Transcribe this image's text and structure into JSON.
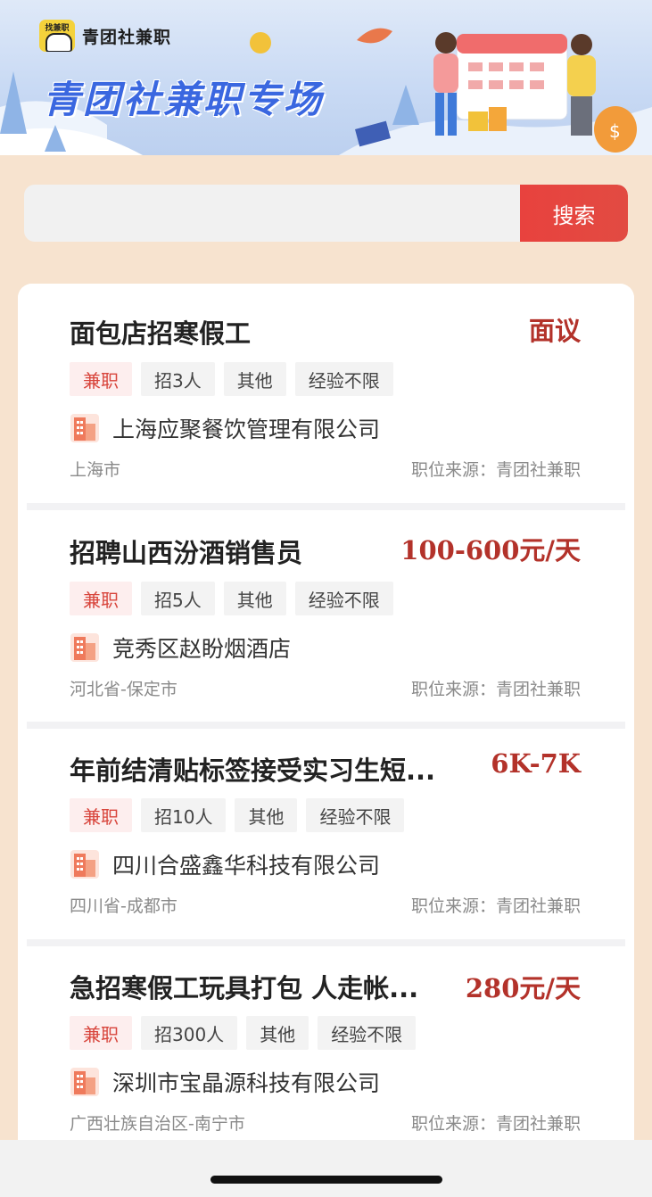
{
  "banner": {
    "brand_badge": "找兼职",
    "brand_name": "青团社兼职",
    "title": "青团社兼职专场"
  },
  "search": {
    "value": "",
    "placeholder": "",
    "button_label": "搜索"
  },
  "jobs": [
    {
      "title": "面包店招寒假工",
      "salary": "面议",
      "tags": [
        "兼职",
        "招3人",
        "其他",
        "经验不限"
      ],
      "company": "上海应聚餐饮管理有限公司",
      "location": "上海市",
      "source": "职位来源：青团社兼职"
    },
    {
      "title": "招聘山西汾酒销售员",
      "salary": "100-600元/天",
      "tags": [
        "兼职",
        "招5人",
        "其他",
        "经验不限"
      ],
      "company": "竞秀区赵盼烟酒店",
      "location": "河北省-保定市",
      "source": "职位来源：青团社兼职"
    },
    {
      "title": "年前结清贴标签接受实习生短...",
      "salary": "6K-7K",
      "tags": [
        "兼职",
        "招10人",
        "其他",
        "经验不限"
      ],
      "company": "四川合盛鑫华科技有限公司",
      "location": "四川省-成都市",
      "source": "职位来源：青团社兼职"
    },
    {
      "title": "急招寒假工玩具打包 人走帐...",
      "salary": "280元/天",
      "tags": [
        "兼职",
        "招300人",
        "其他",
        "经验不限"
      ],
      "company": "深圳市宝晶源科技有限公司",
      "location": "广西壮族自治区-南宁市",
      "source": "职位来源：青团社兼职"
    }
  ],
  "colors": {
    "page_bg": "#f7e3cf",
    "accent_red": "#e8423e",
    "salary_red": "#b3322a",
    "banner_title_blue": "#3a67e0"
  },
  "icons": [
    "building-icon"
  ]
}
